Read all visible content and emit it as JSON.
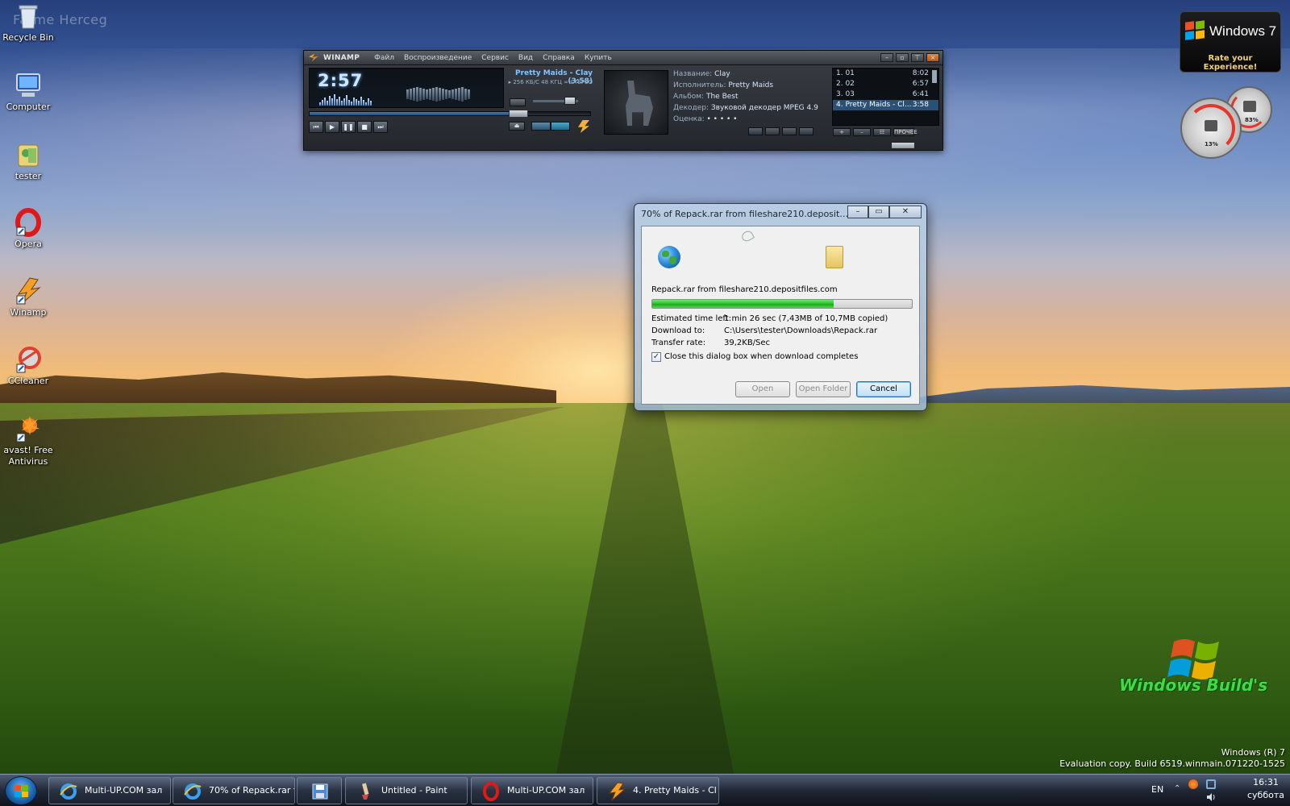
{
  "desktop": {
    "watermark_top": "Fatme Herceg",
    "icons": [
      {
        "label": "Recycle Bin",
        "icon": "recycle-bin-icon"
      },
      {
        "label": "Computer",
        "icon": "computer-icon"
      },
      {
        "label": "tester",
        "icon": "user-folder-icon"
      },
      {
        "label": "Opera",
        "icon": "opera-icon"
      },
      {
        "label": "Winamp",
        "icon": "winamp-icon"
      },
      {
        "label": "CCleaner",
        "icon": "ccleaner-icon"
      },
      {
        "label": "avast! Free Antivirus",
        "icon": "avast-icon"
      }
    ]
  },
  "winamp": {
    "logo": "WINAMP",
    "menu": [
      "Файл",
      "Воспроизведение",
      "Сервис",
      "Вид",
      "Справка",
      "Купить"
    ],
    "time": "2:57",
    "song": "Pretty Maids - Clay (3:58)",
    "bitrate": "▸ 256 КБ/С   48 КГЦ   ∞ СТЕРЕО",
    "seek_fraction": 0.74,
    "volume_fraction": 0.82,
    "info": [
      {
        "key": "Название:",
        "value": "Clay"
      },
      {
        "key": "Исполнитель:",
        "value": "Pretty Maids"
      },
      {
        "key": "Альбом:",
        "value": "The Best"
      },
      {
        "key": "Декодер:",
        "value": "Звуковой декодер MPEG 4.9"
      },
      {
        "key": "Оценка:",
        "value": "• • • • •"
      }
    ],
    "playlist": [
      {
        "title": "1. 01",
        "time": "8:02"
      },
      {
        "title": "2. 02",
        "time": "6:57"
      },
      {
        "title": "3. 03",
        "time": "6:41"
      },
      {
        "title": "4. Pretty Maids - Cl...",
        "time": "3:58"
      }
    ],
    "pl_buttons": [
      "+",
      "–",
      "☷",
      "ПРОЧЕЕ"
    ]
  },
  "gadgets": {
    "win7_title": "Windows 7",
    "win7_rate": "Rate your Experience!",
    "cpu_label": "13%",
    "mem_label": "83%"
  },
  "watermark_bottom": "Windows Build's",
  "eval": {
    "line1": "Windows (R) 7",
    "line2": "Evaluation copy. Build 6519.winmain.071220-1525"
  },
  "dialog": {
    "title": "70% of Repack.rar from fileshare210.depositfiles.c...",
    "filename": "Repack.rar from fileshare210.depositfiles.com",
    "progress_fraction": 0.7,
    "rows": [
      {
        "key": "Estimated time left:",
        "value": "1 min 26 sec (7,43MB of 10,7MB copied)"
      },
      {
        "key": "Download to:",
        "value": "C:\\Users\\tester\\Downloads\\Repack.rar"
      },
      {
        "key": "Transfer rate:",
        "value": "39,2KB/Sec"
      }
    ],
    "checkbox_label": "Close this dialog box when download completes",
    "checkbox_checked": true,
    "btn_open": "Open",
    "btn_folder": "Open Folder",
    "btn_cancel": "Cancel"
  },
  "taskbar": {
    "buttons": [
      {
        "label": "Multi-UP.COM зал",
        "icon": "ie-icon"
      },
      {
        "label": "70% of Repack.rar f",
        "icon": "ie-icon"
      },
      {
        "label": "",
        "icon": "save-disk-icon"
      },
      {
        "label": "Untitled - Paint",
        "icon": "paint-icon"
      },
      {
        "label": "Multi-UP.COM зал",
        "icon": "opera-icon"
      },
      {
        "label": "4. Pretty Maids - Cl",
        "icon": "winamp-icon"
      }
    ],
    "tray_lang": "EN",
    "tray_time": "16:31",
    "tray_day": "суббота"
  },
  "colors": {
    "accent_progress": "#2ec42e",
    "winamp_text": "#7fc6ff",
    "build_green": "#3edc3e"
  }
}
